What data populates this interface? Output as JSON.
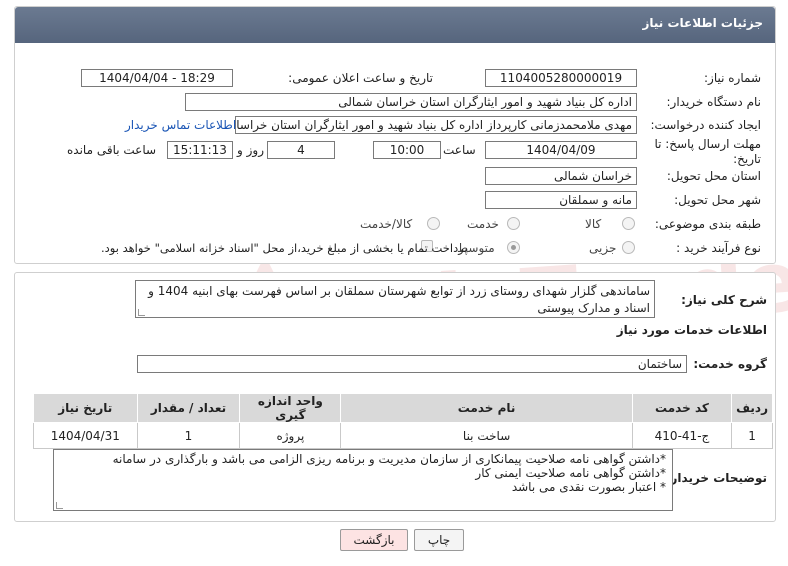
{
  "header": {
    "title": "جزئیات اطلاعات نیاز"
  },
  "fields": {
    "need_number_label": "شماره نیاز:",
    "need_number": "1104005280000019",
    "announce_label": "تاریخ و ساعت اعلان عمومی:",
    "announce_value": "1404/04/04 - 18:29",
    "buyer_org_label": "نام دستگاه خریدار:",
    "buyer_org": "اداره کل بنیاد شهید و امور ایثارگران استان خراسان شمالی",
    "creator_label": "ایجاد کننده درخواست:",
    "creator": "مهدی  ملامحمدزمانی کارپرداز اداره کل بنیاد شهید و امور ایثارگران استان خراسان شمالی",
    "contact_link": "اطلاعات تماس خریدار",
    "deadline_label_1": "مهلت ارسال پاسخ: تا",
    "deadline_label_2": "تاریخ:",
    "deadline_date": "1404/04/09",
    "time_label": "ساعت",
    "deadline_time": "10:00",
    "days_value": "4",
    "days_label": "روز و",
    "remaining_time": "15:11:13",
    "remaining_label": "ساعت باقی مانده",
    "province_label": "استان محل تحویل:",
    "province": "خراسان شمالی",
    "city_label": "شهر محل تحویل:",
    "city": "مانه و سملقان",
    "category_label": "طبقه بندی موضوعی:",
    "category_options": [
      "کالا",
      "خدمت",
      "کالا/خدمت"
    ],
    "process_label": "نوع فرآیند خرید :",
    "process_options": [
      "جزیی",
      "متوسط"
    ],
    "payment_note": "پرداخت تمام یا بخشی از مبلغ خرید،از محل \"اسناد خزانه اسلامی\" خواهد بود."
  },
  "details": {
    "summary_label": "شرح کلی نیاز:",
    "summary": "ساماندهی گلزار شهدای روستای زرد از توابع شهرستان سملقان بر اساس فهرست بهای ابنیه 1404 و اسناد و مدارک پیوستی",
    "services_title": "اطلاعات خدمات مورد نیاز",
    "group_label": "گروه خدمت:",
    "group_value": "ساختمان",
    "table_headers": [
      "ردیف",
      "کد خدمت",
      "نام خدمت",
      "واحد اندازه گیری",
      "تعداد / مقدار",
      "تاریخ نیاز"
    ],
    "table_rows": [
      [
        "1",
        "ج-41-410",
        "ساخت بنا",
        "پروژه",
        "1",
        "1404/04/31"
      ]
    ],
    "notes_label": "توضیحات خریدار:",
    "notes": [
      "*داشتن گواهی نامه صلاحیت پیمانکاری از سازمان مدیریت و برنامه ریزی الزامی می باشد و بارگذاری در سامانه",
      "*داشتن گواهی نامه صلاحیت ایمنی کار",
      "* اعتبار بصورت نقدی می باشد"
    ]
  },
  "buttons": {
    "print": "چاپ",
    "back": "بازگشت"
  },
  "watermark": "AriaTender.neT",
  "colors": {
    "header": "#5f6e86",
    "link": "#1a55b5",
    "back_button": "#fde3e3"
  }
}
